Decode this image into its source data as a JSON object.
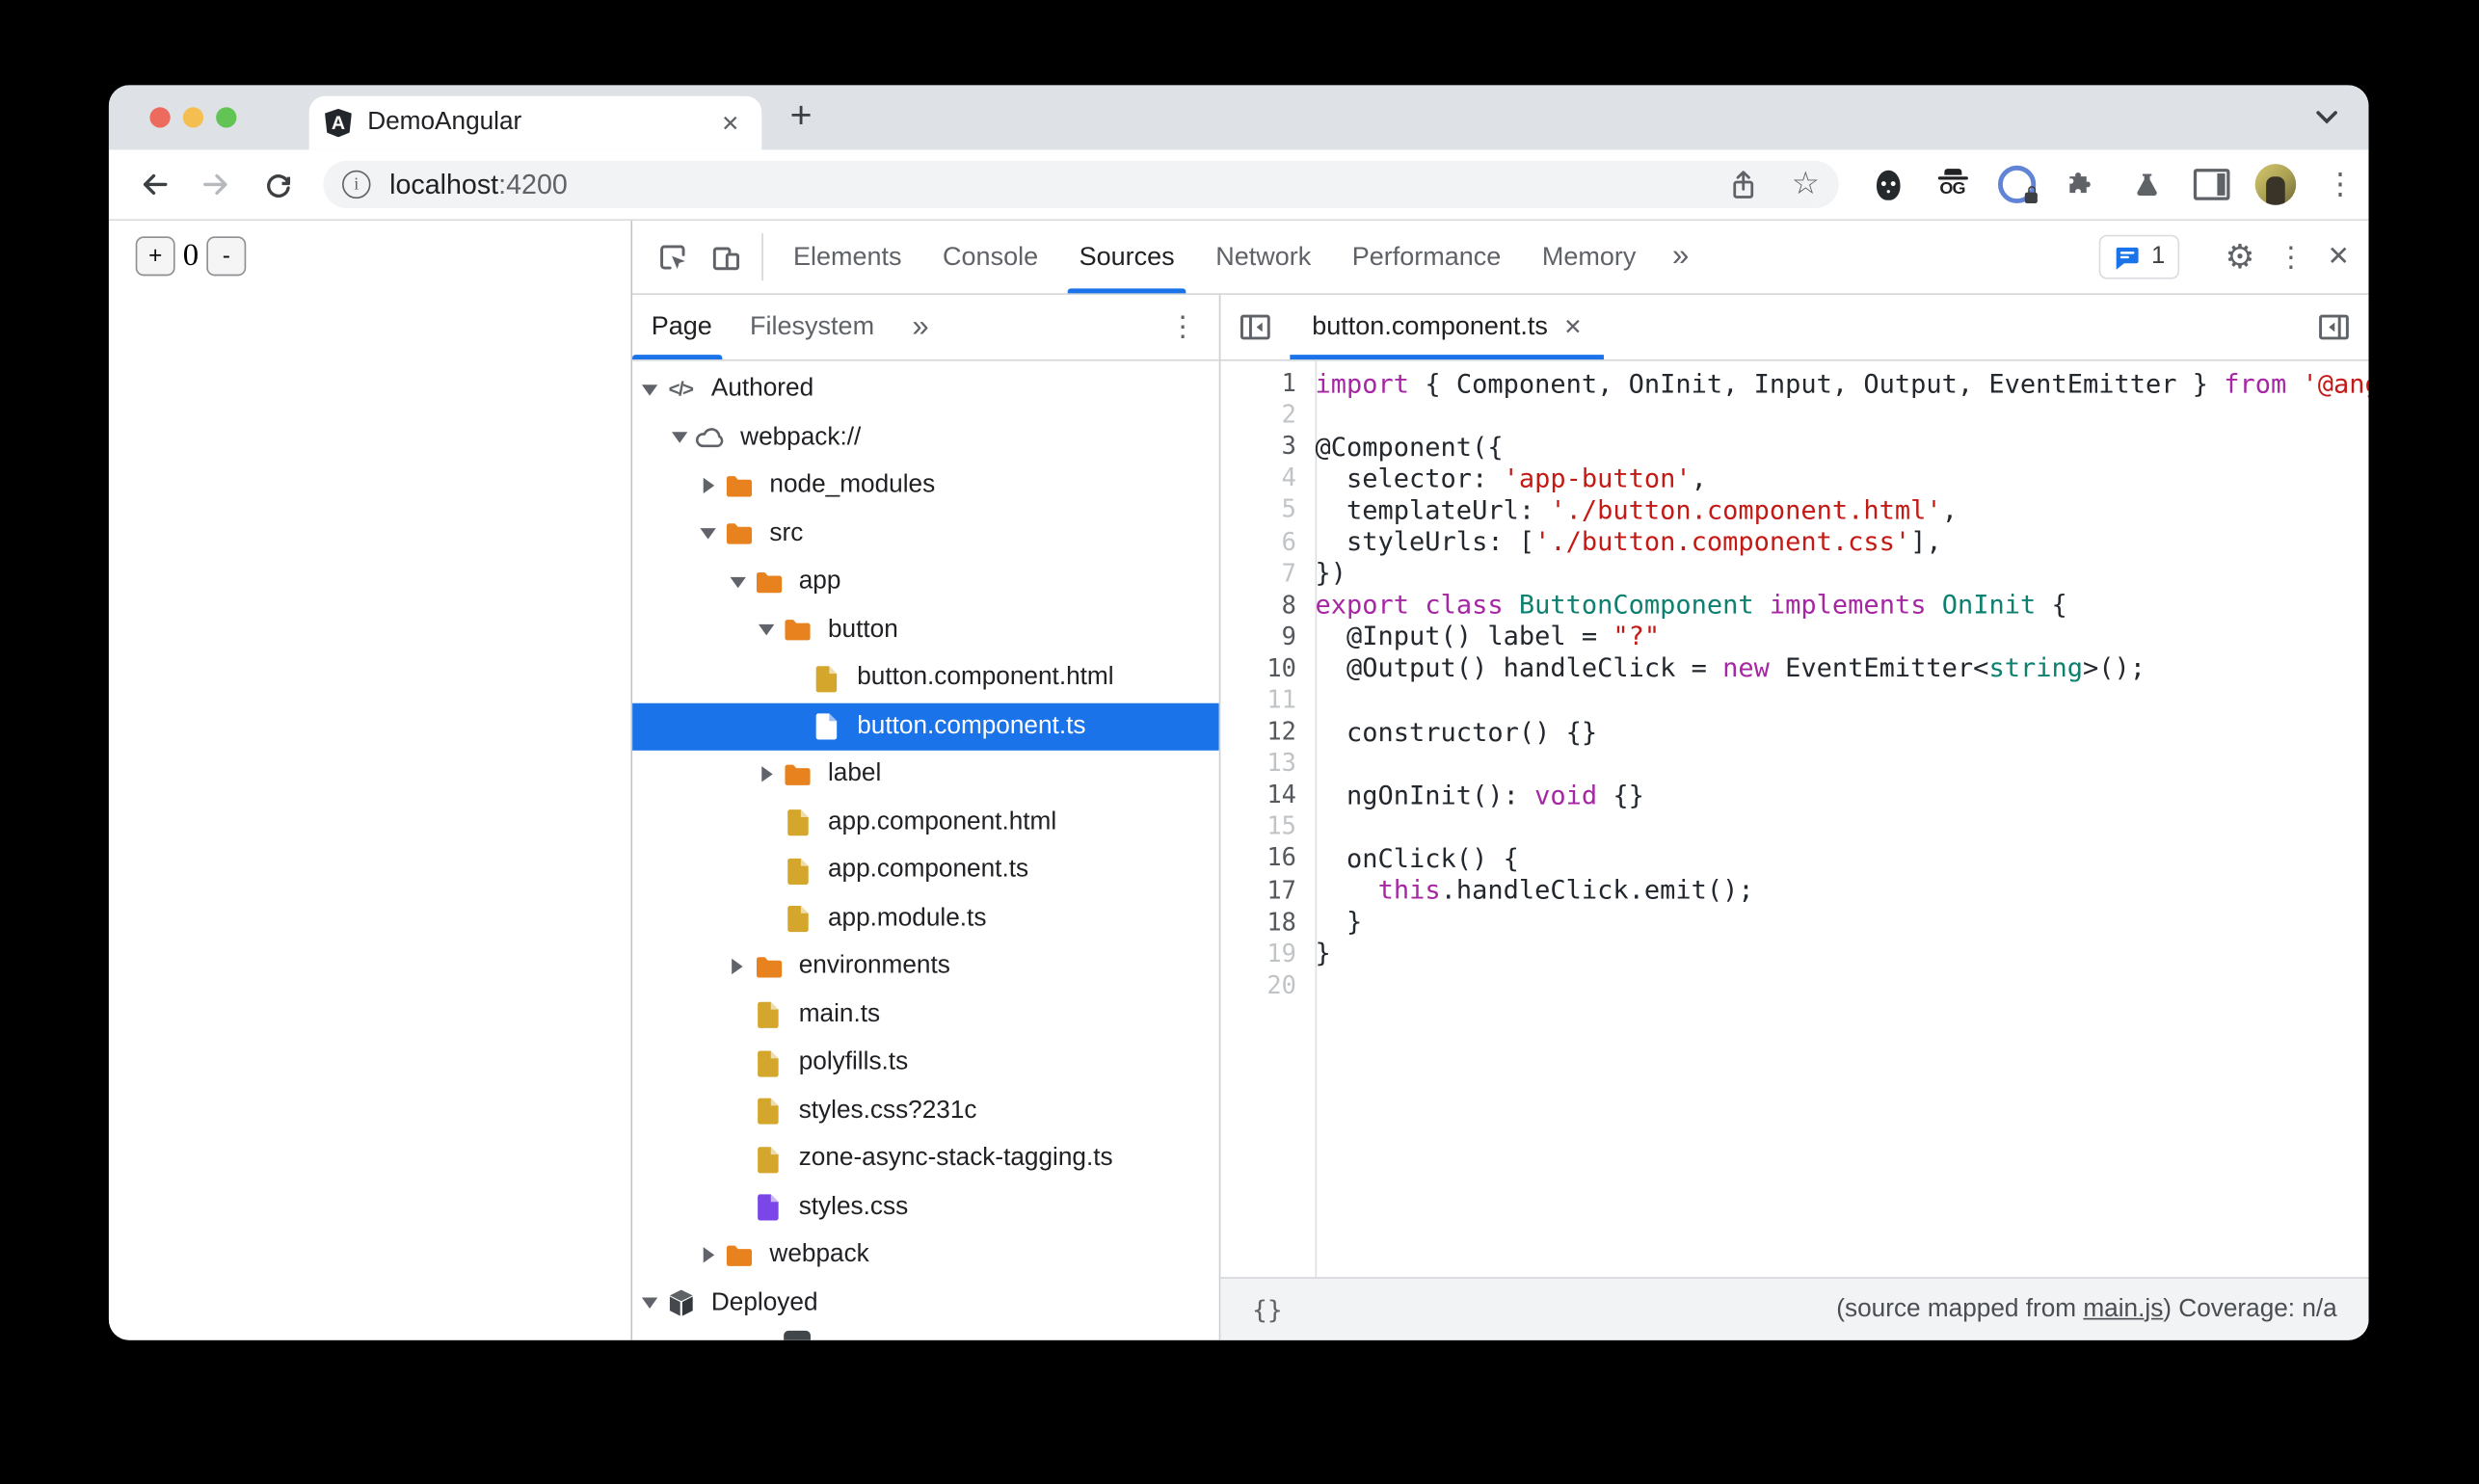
{
  "colors": {
    "accent": "#1A73E8",
    "selection": "#1A73E8",
    "folder": "#E8821E",
    "file_yellow": "#D4A72C",
    "file_purple": "#7A46E8",
    "keyword": "#A626A4",
    "string": "#C41A16",
    "type": "#0D8070",
    "tabstrip": "#DEE1E6"
  },
  "browser": {
    "tab": {
      "title": "DemoAngular",
      "close_glyph": "✕",
      "new_tab_glyph": "+"
    },
    "url": {
      "host": "localhost",
      "port": ":4200"
    },
    "bookmark_star_glyph": "☆",
    "menu_dots_glyph": "⋮"
  },
  "page": {
    "counter": {
      "plus_label": "+",
      "value": "0",
      "minus_label": "-"
    }
  },
  "devtools": {
    "tabs": [
      "Elements",
      "Console",
      "Sources",
      "Network",
      "Performance",
      "Memory"
    ],
    "active_tab": "Sources",
    "more_tabs_glyph": "»",
    "issues_count": "1",
    "gear_glyph": "⚙",
    "vdots_glyph": "⋮",
    "close_glyph": "✕",
    "navigator": {
      "tabs": [
        "Page",
        "Filesystem"
      ],
      "active_tab": "Page",
      "more_glyph": "»",
      "dots_glyph": "⋮",
      "tree": [
        {
          "label": "Authored",
          "level": 0,
          "icon": "code",
          "arrow": "down"
        },
        {
          "label": "webpack://",
          "level": 1,
          "icon": "cloud",
          "arrow": "down"
        },
        {
          "label": "node_modules",
          "level": 2,
          "icon": "folder",
          "arrow": "right"
        },
        {
          "label": "src",
          "level": 2,
          "icon": "folder",
          "arrow": "down"
        },
        {
          "label": "app",
          "level": 3,
          "icon": "folder",
          "arrow": "down"
        },
        {
          "label": "button",
          "level": 4,
          "icon": "folder",
          "arrow": "down"
        },
        {
          "label": "button.component.html",
          "level": 5,
          "icon": "file",
          "color": "yellow"
        },
        {
          "label": "button.component.ts",
          "level": 5,
          "icon": "file",
          "color": "white",
          "selected": true
        },
        {
          "label": "label",
          "level": 4,
          "icon": "folder",
          "arrow": "right"
        },
        {
          "label": "app.component.html",
          "level": 4,
          "icon": "file",
          "color": "yellow"
        },
        {
          "label": "app.component.ts",
          "level": 4,
          "icon": "file",
          "color": "yellow"
        },
        {
          "label": "app.module.ts",
          "level": 4,
          "icon": "file",
          "color": "yellow"
        },
        {
          "label": "environments",
          "level": 3,
          "icon": "folder",
          "arrow": "right"
        },
        {
          "label": "main.ts",
          "level": 3,
          "icon": "file",
          "color": "yellow"
        },
        {
          "label": "polyfills.ts",
          "level": 3,
          "icon": "file",
          "color": "yellow"
        },
        {
          "label": "styles.css?231c",
          "level": 3,
          "icon": "file",
          "color": "yellow"
        },
        {
          "label": "zone-async-stack-tagging.ts",
          "level": 3,
          "icon": "file",
          "color": "yellow"
        },
        {
          "label": "styles.css",
          "level": 3,
          "icon": "file",
          "color": "purple"
        },
        {
          "label": "webpack",
          "level": 2,
          "icon": "folder",
          "arrow": "right"
        },
        {
          "label": "Deployed",
          "level": 0,
          "icon": "cube",
          "arrow": "down"
        },
        {
          "label": "",
          "level": 4,
          "icon": "frame",
          "partial": true
        }
      ]
    },
    "editor": {
      "tab_title": "button.component.ts",
      "tab_close_glyph": "✕",
      "dim_line_numbers": [
        2,
        4,
        5,
        6,
        7,
        11,
        13,
        15,
        19,
        20
      ],
      "lines": [
        {
          "n": 1,
          "tokens": [
            [
              "k",
              "import"
            ],
            [
              "d",
              " { Component, OnInit, Input, Output, EventEmitter } "
            ],
            [
              "k",
              "from"
            ],
            [
              "d",
              " "
            ],
            [
              "s",
              "'@angular/core';"
            ]
          ]
        },
        {
          "n": 2,
          "tokens": []
        },
        {
          "n": 3,
          "tokens": [
            [
              "d",
              "@Component({"
            ]
          ]
        },
        {
          "n": 4,
          "tokens": [
            [
              "d",
              "  selector: "
            ],
            [
              "s",
              "'app-button'"
            ],
            [
              "d",
              ","
            ]
          ]
        },
        {
          "n": 5,
          "tokens": [
            [
              "d",
              "  templateUrl: "
            ],
            [
              "s",
              "'./button.component.html'"
            ],
            [
              "d",
              ","
            ]
          ]
        },
        {
          "n": 6,
          "tokens": [
            [
              "d",
              "  styleUrls: ["
            ],
            [
              "s",
              "'./button.component.css'"
            ],
            [
              "d",
              "],"
            ]
          ]
        },
        {
          "n": 7,
          "tokens": [
            [
              "d",
              "})"
            ]
          ]
        },
        {
          "n": 8,
          "tokens": [
            [
              "k",
              "export"
            ],
            [
              "d",
              " "
            ],
            [
              "k",
              "class"
            ],
            [
              "d",
              " "
            ],
            [
              "t",
              "ButtonComponent"
            ],
            [
              "d",
              " "
            ],
            [
              "k",
              "implements"
            ],
            [
              "d",
              " "
            ],
            [
              "t",
              "OnInit"
            ],
            [
              "d",
              " {"
            ]
          ]
        },
        {
          "n": 9,
          "tokens": [
            [
              "d",
              "  @Input() label = "
            ],
            [
              "s",
              "\"?\""
            ]
          ]
        },
        {
          "n": 10,
          "tokens": [
            [
              "d",
              "  @Output() handleClick = "
            ],
            [
              "k",
              "new"
            ],
            [
              "d",
              " EventEmitter<"
            ],
            [
              "t",
              "string"
            ],
            [
              "d",
              ">();"
            ]
          ]
        },
        {
          "n": 11,
          "tokens": []
        },
        {
          "n": 12,
          "tokens": [
            [
              "d",
              "  constructor() {}"
            ]
          ]
        },
        {
          "n": 13,
          "tokens": []
        },
        {
          "n": 14,
          "tokens": [
            [
              "d",
              "  ngOnInit(): "
            ],
            [
              "k",
              "void"
            ],
            [
              "d",
              " {}"
            ]
          ]
        },
        {
          "n": 15,
          "tokens": []
        },
        {
          "n": 16,
          "tokens": [
            [
              "d",
              "  onClick() {"
            ]
          ]
        },
        {
          "n": 17,
          "tokens": [
            [
              "d",
              "    "
            ],
            [
              "k",
              "this"
            ],
            [
              "d",
              ".handleClick.emit();"
            ]
          ]
        },
        {
          "n": 18,
          "tokens": [
            [
              "d",
              "  }"
            ]
          ]
        },
        {
          "n": 19,
          "tokens": [
            [
              "d",
              "}"
            ]
          ]
        },
        {
          "n": 20,
          "tokens": []
        }
      ]
    },
    "statusbar": {
      "pretty_print_glyph": "{}",
      "mapped_prefix": "(source mapped from ",
      "mapped_link": "main.js",
      "mapped_suffix": ")",
      "coverage_text": " Coverage: n/a"
    }
  }
}
